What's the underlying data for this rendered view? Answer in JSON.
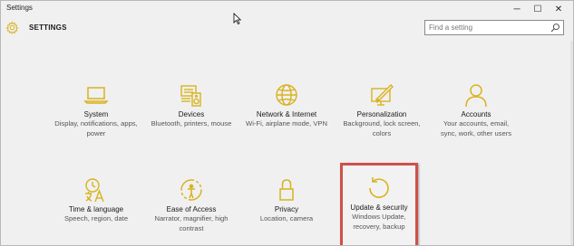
{
  "window": {
    "title": "Settings",
    "controls": {
      "minimize": "─",
      "maximize": "☐",
      "close": "✕"
    }
  },
  "header": {
    "title": "SETTINGS",
    "icon": "gear-icon"
  },
  "search": {
    "placeholder": "Find a setting",
    "value": "",
    "icon": "search-icon"
  },
  "colors": {
    "accent": "#d8b31e",
    "highlight_border": "#d0504b"
  },
  "tiles": [
    {
      "id": "system",
      "name": "System",
      "desc": "Display, notifications, apps, power",
      "icon": "laptop-icon"
    },
    {
      "id": "devices",
      "name": "Devices",
      "desc": "Bluetooth, printers, mouse",
      "icon": "keyboard-speaker-icon"
    },
    {
      "id": "network",
      "name": "Network & Internet",
      "desc": "Wi-Fi, airplane mode, VPN",
      "icon": "globe-icon"
    },
    {
      "id": "personalization",
      "name": "Personalization",
      "desc": "Background, lock screen, colors",
      "icon": "paint-monitor-icon"
    },
    {
      "id": "accounts",
      "name": "Accounts",
      "desc": "Your accounts, email, sync, work, other users",
      "icon": "person-icon"
    },
    {
      "id": "time",
      "name": "Time & language",
      "desc": "Speech, region, date",
      "icon": "clock-language-icon"
    },
    {
      "id": "ease",
      "name": "Ease of Access",
      "desc": "Narrator, magnifier, high contrast",
      "icon": "ease-of-access-icon"
    },
    {
      "id": "privacy",
      "name": "Privacy",
      "desc": "Location, camera",
      "icon": "lock-icon"
    },
    {
      "id": "update",
      "name": "Update & security",
      "desc": "Windows Update, recovery, backup",
      "icon": "refresh-icon",
      "highlighted": true
    }
  ]
}
